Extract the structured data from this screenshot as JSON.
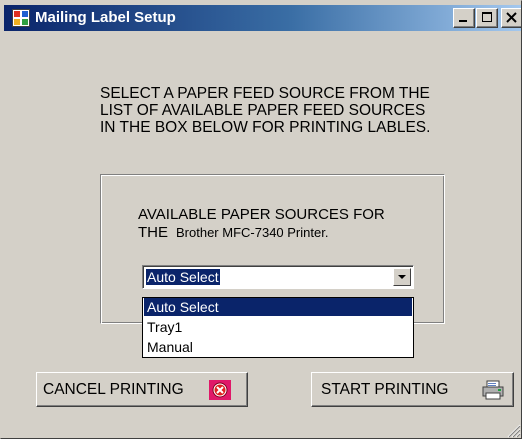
{
  "window": {
    "title": "Mailing Label Setup",
    "icon": "application-icon"
  },
  "caption_buttons": {
    "minimize_icon": "minimize-icon",
    "maximize_icon": "maximize-icon",
    "close_icon": "close-icon"
  },
  "instruction": "SELECT A PAPER FEED SOURCE FROM THE\nLIST OF AVAILABLE PAPER FEED SOURCES\nIN THE BOX BELOW FOR PRINTING LABLES.",
  "paper_source_group": {
    "heading_line1": "AVAILABLE PAPER SOURCES FOR",
    "heading_line2_prefix": "THE",
    "printer_name": "Brother MFC-7340 Printer."
  },
  "paper_source_combo": {
    "selected_value": "Auto Select",
    "options": [
      "Auto Select",
      "Tray1",
      "Manual"
    ],
    "highlighted_index": 0
  },
  "buttons": {
    "cancel_label": "CANCEL PRINTING",
    "cancel_icon": "cancel-icon",
    "start_label": "START PRINTING",
    "start_icon": "printer-icon"
  },
  "colors": {
    "title_bar_start": "#0a246a",
    "title_bar_end": "#a6caf0",
    "selection": "#0a246a",
    "window_face": "#d4d0c8",
    "cancel_icon_bg": "#e01868"
  }
}
